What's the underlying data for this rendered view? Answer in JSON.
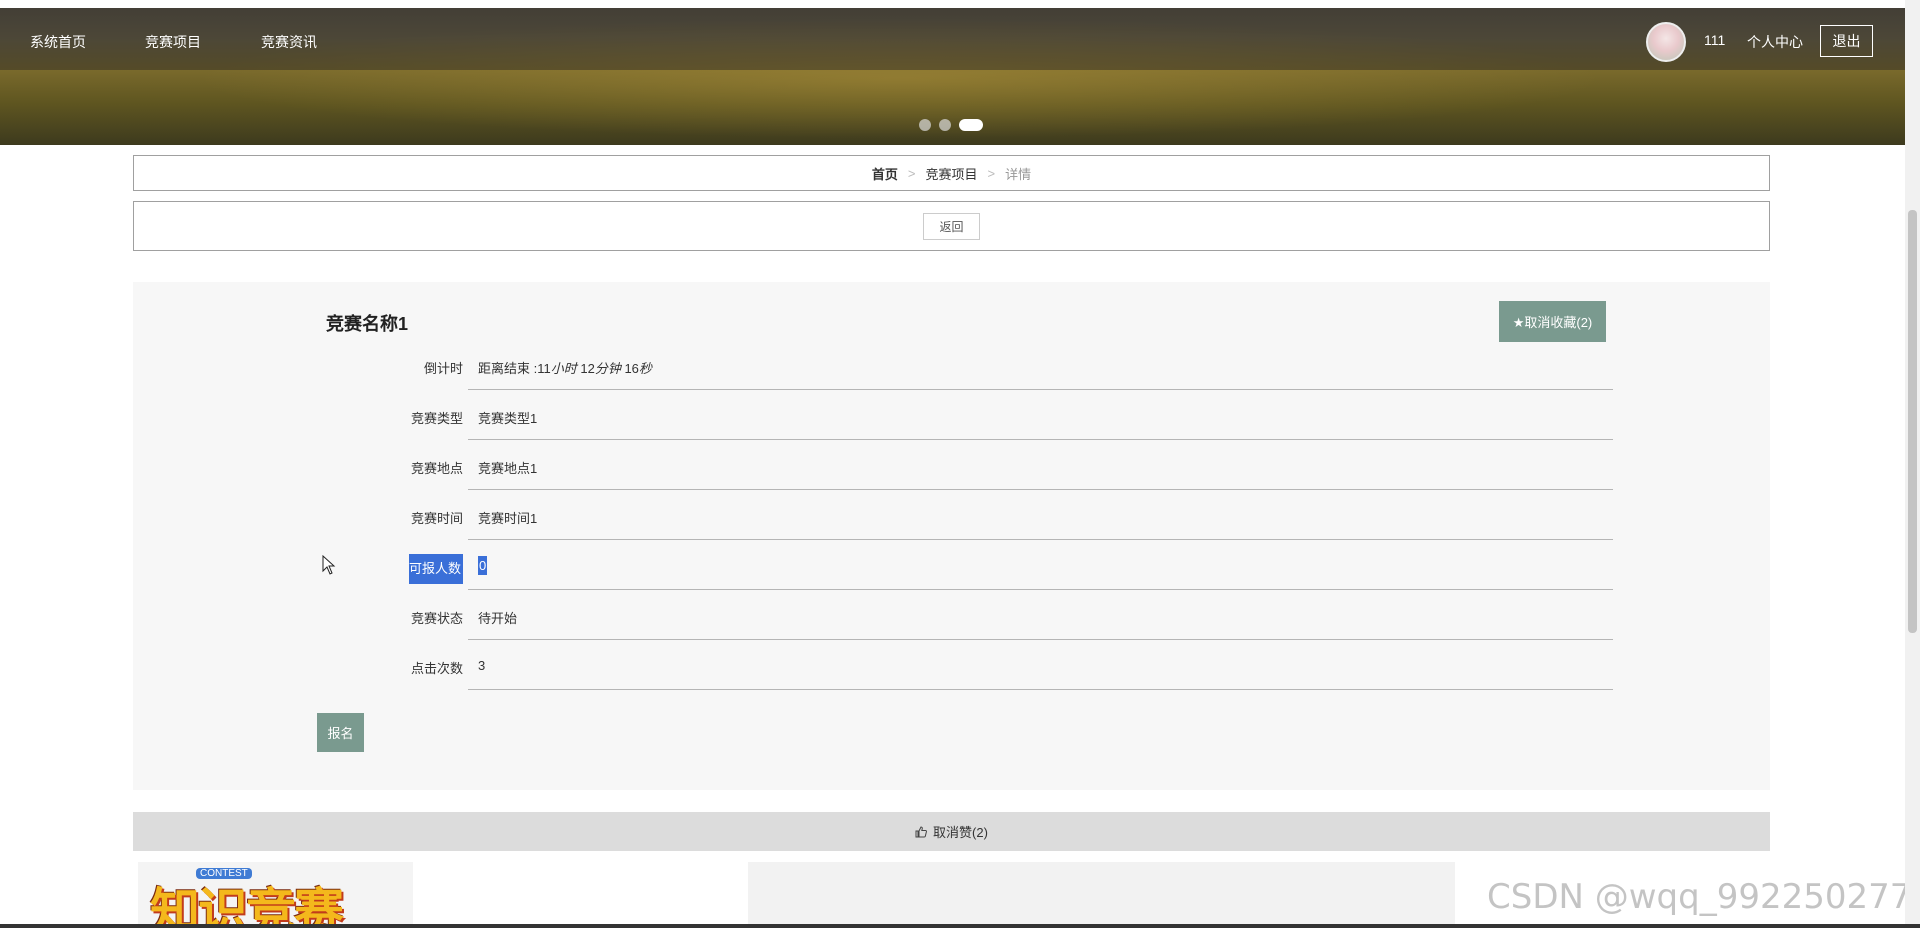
{
  "nav": {
    "items": [
      "系统首页",
      "竞赛项目",
      "竞赛资讯"
    ],
    "username": "111",
    "center": "个人中心",
    "logout": "退出"
  },
  "breadcrumb": {
    "home": "首页",
    "sep": ">",
    "section": "竞赛项目",
    "current": "详情"
  },
  "return_label": "返回",
  "detail": {
    "title": "竞赛名称1",
    "favorite_btn": "★取消收藏(2)",
    "rows": [
      {
        "label": "倒计时",
        "value": "距离结束 :11小时 12分钟 16秒"
      },
      {
        "label": "竞赛类型",
        "value": "竞赛类型1"
      },
      {
        "label": "竞赛地点",
        "value": "竞赛地点1"
      },
      {
        "label": "竞赛时间",
        "value": "竞赛时间1"
      },
      {
        "label": "可报人数",
        "value": "0"
      },
      {
        "label": "竞赛状态",
        "value": "待开始"
      },
      {
        "label": "点击次数",
        "value": "3"
      }
    ],
    "countdown_prefix": "距离结束 :11",
    "countdown_h": "小时",
    "countdown_m_num": " 12",
    "countdown_m": "分钟",
    "countdown_s_num": " 16",
    "countdown_s": "秒",
    "signup_btn": "报名"
  },
  "like_bar": {
    "label": "取消赞(2)",
    "icon": "thumbs-up-icon"
  },
  "thumb": {
    "text": "知识竞赛",
    "badge": "CONTEST"
  },
  "watermark": "CSDN @wqq_992250277",
  "carousel": {
    "count": 3,
    "active_index": 2
  }
}
